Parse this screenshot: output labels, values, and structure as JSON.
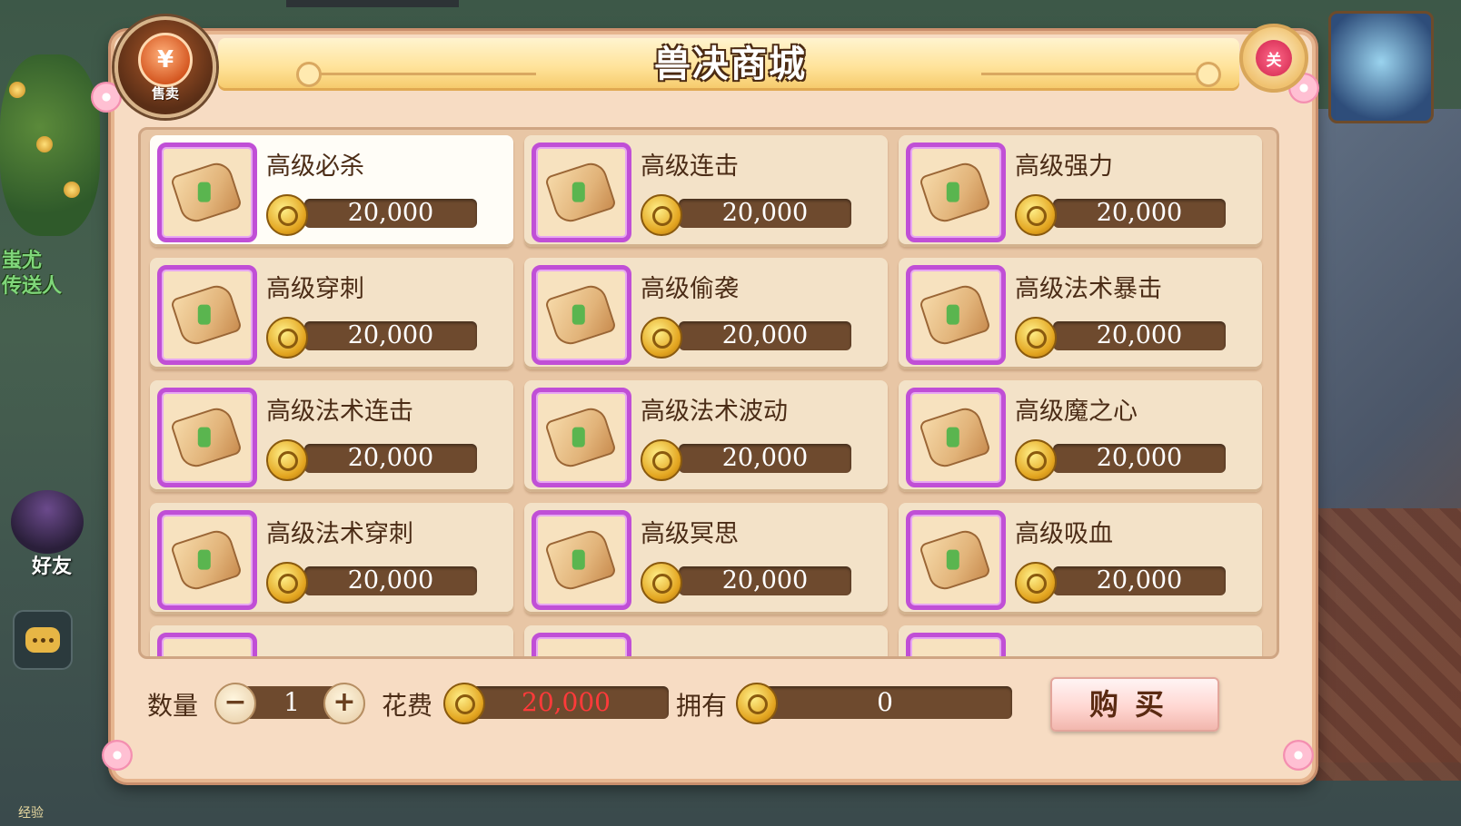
{
  "background": {
    "npc_name": "蚩尤",
    "npc_role": "传送人",
    "friend_label": "好友",
    "exp_label": "经验"
  },
  "header": {
    "title": "兽决商城",
    "sell_button": "售卖",
    "sell_icon_glyph": "¥",
    "close_button": "关"
  },
  "items": [
    {
      "name": "高级必杀",
      "price": "20,000",
      "selected": true
    },
    {
      "name": "高级连击",
      "price": "20,000"
    },
    {
      "name": "高级强力",
      "price": "20,000"
    },
    {
      "name": "高级穿刺",
      "price": "20,000"
    },
    {
      "name": "高级偷袭",
      "price": "20,000"
    },
    {
      "name": "高级法术暴击",
      "price": "20,000"
    },
    {
      "name": "高级法术连击",
      "price": "20,000"
    },
    {
      "name": "高级法术波动",
      "price": "20,000"
    },
    {
      "name": "高级魔之心",
      "price": "20,000"
    },
    {
      "name": "高级法术穿刺",
      "price": "20,000"
    },
    {
      "name": "高级冥思",
      "price": "20,000"
    },
    {
      "name": "高级吸血",
      "price": "20,000"
    }
  ],
  "footer": {
    "quantity_label": "数量",
    "quantity_minus": "−",
    "quantity_value": "1",
    "quantity_plus": "+",
    "cost_label": "花费",
    "cost_value": "20,000",
    "owned_label": "拥有",
    "owned_value": "0",
    "buy_button": "购买"
  },
  "colors": {
    "panel_bg": "#f7dcc3",
    "price_bar": "#6e4a2e",
    "cost_text": "#ff3a3a",
    "item_border": "#c04fd6"
  },
  "icons": {
    "item_icon": "beast-skill-scroll-icon",
    "currency_icon": "gold-coin-icon",
    "close_icon": "close-icon",
    "sell_icon": "sell-coin-icon",
    "chat_icon": "chat-bubble-icon"
  }
}
